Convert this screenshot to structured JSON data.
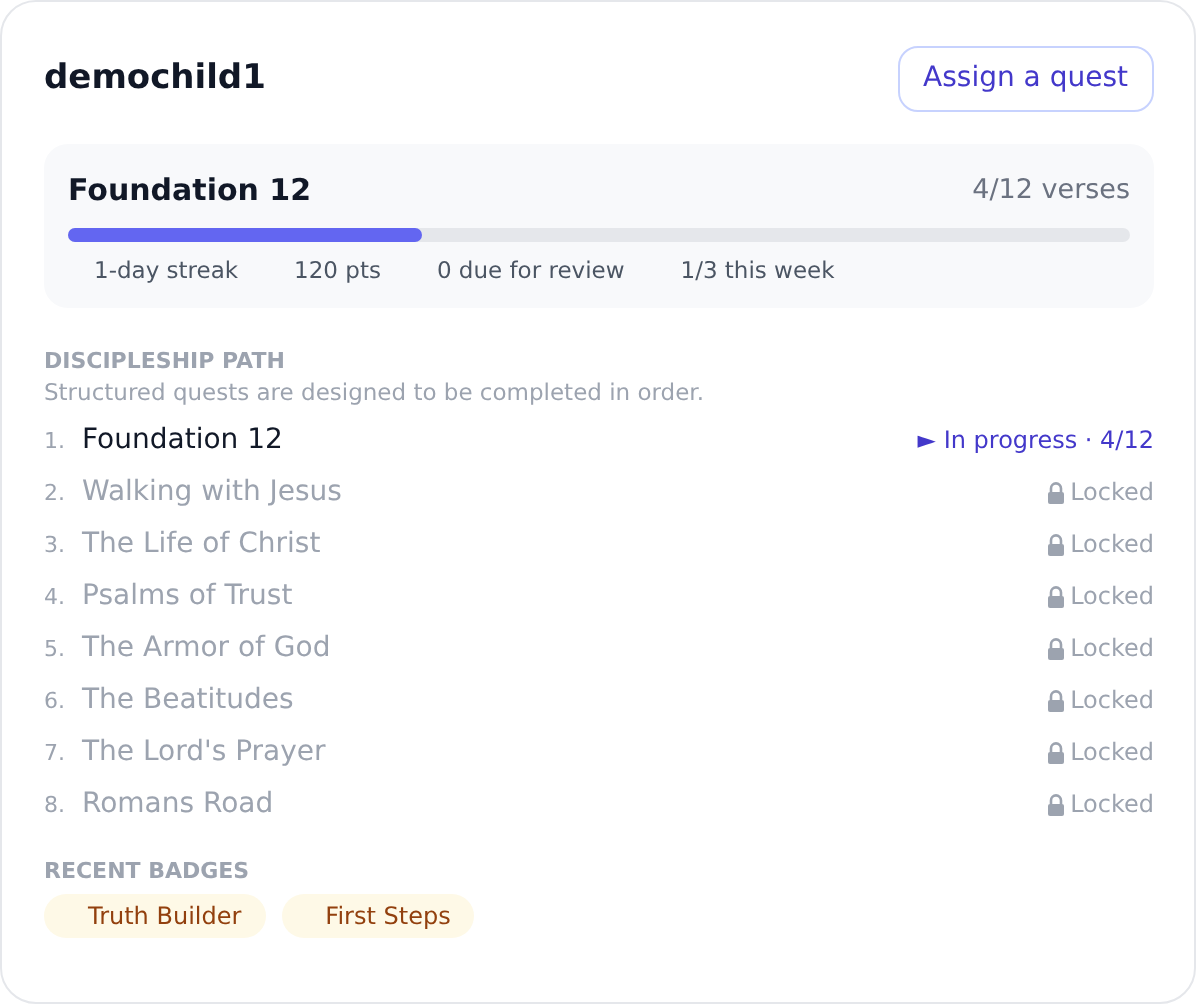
{
  "header": {
    "title": "demochild1",
    "button": "Assign a quest"
  },
  "current": {
    "title": "Foundation 12",
    "count": "4/12 verses",
    "level": 0.333,
    "stats": [
      "1-day streak",
      "120 pts",
      "0 due for review",
      "1/3 this week"
    ]
  },
  "path": {
    "heading": "DISCIPLESHIP PATH",
    "subtitle": "Structured quests are designed to be completed in order.",
    "quests": [
      {
        "number": "1.",
        "name": "Foundation 12",
        "kind": "in_progress",
        "status": "► In progress · 4/12"
      },
      {
        "number": "2.",
        "name": "Walking with Jesus",
        "kind": "locked",
        "status": "Locked"
      },
      {
        "number": "3.",
        "name": "The Life of Christ",
        "kind": "locked",
        "status": "Locked"
      },
      {
        "number": "4.",
        "name": "Psalms of Trust",
        "kind": "locked",
        "status": "Locked"
      },
      {
        "number": "5.",
        "name": "The Armor of God",
        "kind": "locked",
        "status": "Locked"
      },
      {
        "number": "6.",
        "name": "The Beatitudes",
        "kind": "locked",
        "status": "Locked"
      },
      {
        "number": "7.",
        "name": "The Lord's Prayer",
        "kind": "locked",
        "status": "Locked"
      },
      {
        "number": "8.",
        "name": "Romans Road",
        "kind": "locked",
        "status": "Locked"
      }
    ]
  },
  "badges": {
    "heading": "RECENT BADGES",
    "items": [
      "Truth Builder",
      "First Steps"
    ]
  }
}
